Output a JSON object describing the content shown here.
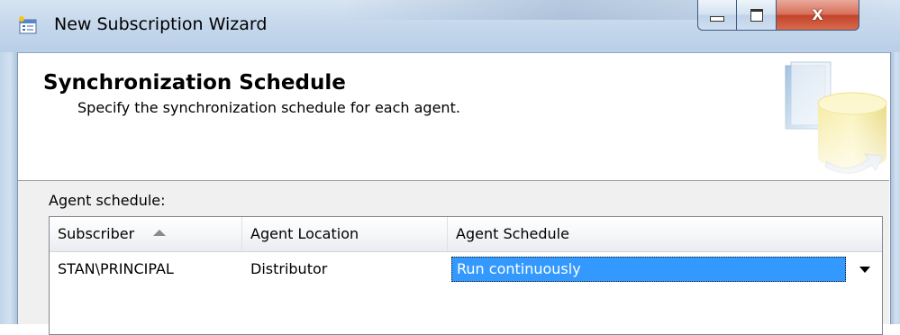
{
  "window": {
    "title": "New Subscription Wizard",
    "icon": "wizard-app-icon",
    "buttons": {
      "minimize_icon": "minimize-icon",
      "maximize_icon": "maximize-icon",
      "close_glyph": "X"
    }
  },
  "header": {
    "title": "Synchronization Schedule",
    "subtitle": "Specify the synchronization schedule for each agent.",
    "graphic": "database-sync-icon"
  },
  "main": {
    "grid_label": "Agent schedule:",
    "columns": [
      {
        "label": "Subscriber",
        "sort": "ascending"
      },
      {
        "label": "Agent Location"
      },
      {
        "label": "Agent Schedule"
      }
    ],
    "rows": [
      {
        "subscriber": "STAN\\PRINCIPAL",
        "location": "Distributor",
        "schedule": "Run continuously"
      }
    ]
  },
  "colors": {
    "selection": "#3399ff",
    "titlebar": "#c6d8ec",
    "close_button": "#c2442a",
    "body_background": "#f0f0f0"
  }
}
